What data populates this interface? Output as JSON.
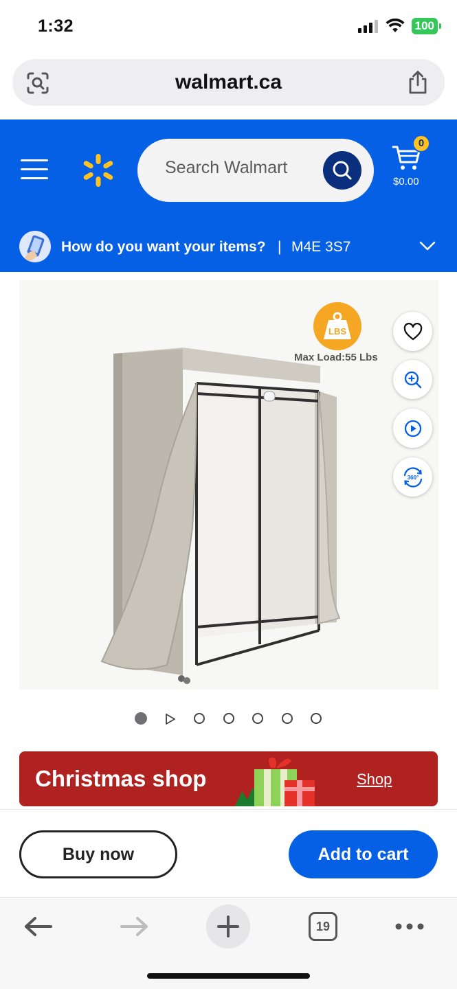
{
  "status_bar": {
    "time": "1:32",
    "battery": "100"
  },
  "browser": {
    "url": "walmart.ca",
    "tabs_count": "19"
  },
  "header": {
    "search_placeholder": "Search Walmart",
    "cart_count": "0",
    "cart_total": "$0.00",
    "delivery_question": "How do you want your items?",
    "delivery_separator": "|",
    "postal_code": "M4E 3S7"
  },
  "product": {
    "badge_text": "LBS",
    "max_load": "Max Load:55 Lbs"
  },
  "banner": {
    "title": "Christmas shop",
    "link": "Shop"
  },
  "actions": {
    "buy_now": "Buy now",
    "add_to_cart": "Add to cart"
  },
  "colors": {
    "brand_blue": "#0560e5",
    "spark_yellow": "#ffc220",
    "banner_red": "#b0221f"
  }
}
